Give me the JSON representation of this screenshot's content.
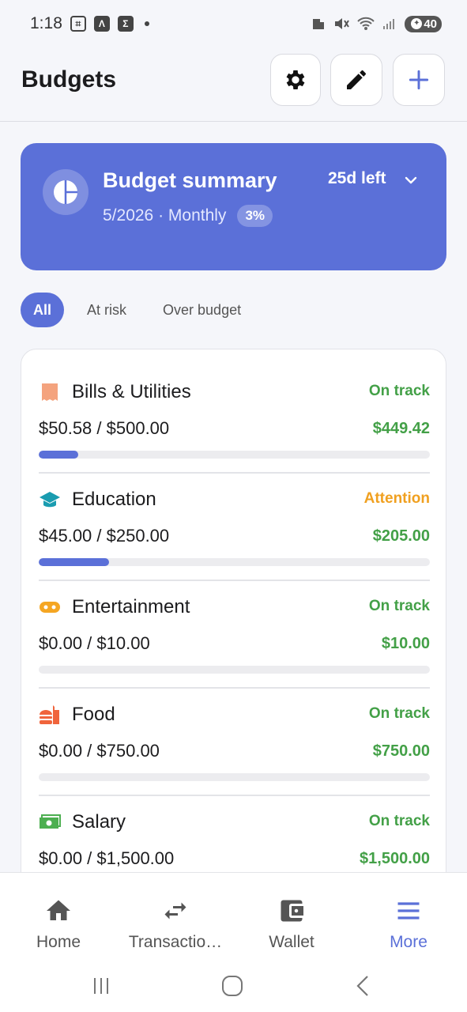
{
  "status_bar": {
    "time": "1:18",
    "battery": "40"
  },
  "header": {
    "title": "Budgets"
  },
  "summary": {
    "title": "Budget summary",
    "period": "5/2026 · Monthly",
    "percent": "3%",
    "days_left": "25d left"
  },
  "filters": [
    {
      "label": "All",
      "active": true
    },
    {
      "label": "At risk",
      "active": false
    },
    {
      "label": "Over budget",
      "active": false
    }
  ],
  "budgets": [
    {
      "name": "Bills & Utilities",
      "status": "On track",
      "status_color": "#43a047",
      "amount": "$50.58 / $500.00",
      "remaining": "$449.42",
      "progress": 0.1,
      "icon": "receipt-icon",
      "icon_color": "#f4a37e"
    },
    {
      "name": "Education",
      "status": "Attention",
      "status_color": "#f0a020",
      "amount": "$45.00 / $250.00",
      "remaining": "$205.00",
      "progress": 0.18,
      "icon": "graduation-cap-icon",
      "icon_color": "#1a9cb0"
    },
    {
      "name": "Entertainment",
      "status": "On track",
      "status_color": "#43a047",
      "amount": "$0.00 / $10.00",
      "remaining": "$10.00",
      "progress": 0,
      "icon": "gamepad-icon",
      "icon_color": "#f5a623"
    },
    {
      "name": "Food",
      "status": "On track",
      "status_color": "#43a047",
      "amount": "$0.00 / $750.00",
      "remaining": "$750.00",
      "progress": 0,
      "icon": "burger-drink-icon",
      "icon_color": "#f0643c"
    },
    {
      "name": "Salary",
      "status": "On track",
      "status_color": "#43a047",
      "amount": "$0.00 / $1,500.00",
      "remaining": "$1,500.00",
      "progress": 0,
      "icon": "cash-icon",
      "icon_color": "#4caf50"
    }
  ],
  "bottom_nav": [
    {
      "label": "Home",
      "icon": "home-icon",
      "active": false
    },
    {
      "label": "Transactio…",
      "icon": "transfer-arrows-icon",
      "active": false
    },
    {
      "label": "Wallet",
      "icon": "wallet-icon",
      "active": false
    },
    {
      "label": "More",
      "icon": "menu-icon",
      "active": true
    }
  ],
  "colors": {
    "accent": "#5b70d8",
    "on_track": "#43a047",
    "attention": "#f0a020"
  }
}
